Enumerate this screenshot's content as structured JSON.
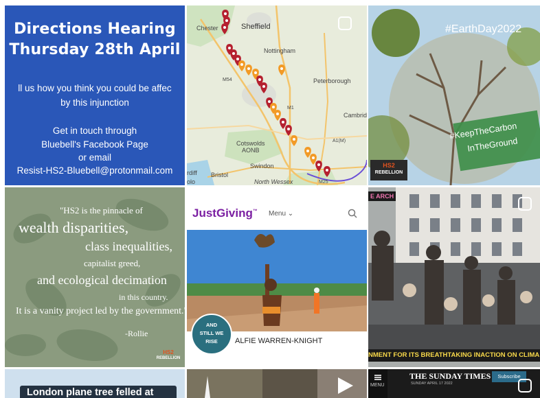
{
  "tiles": {
    "directions": {
      "title_line1": "Directions Hearing",
      "title_line2": "Thursday 28th April",
      "body_line1": "ll us how you think you could be affec",
      "body_line2": "by this injunction",
      "body_line3": "Get in touch through",
      "body_line4": "Bluebell's Facebook Page",
      "body_line5": "or email",
      "body_line6": "Resist-HS2-Bluebell@protonmail.com"
    },
    "map": {
      "labels": {
        "chester": "Chester",
        "sheffield": "Sheffield",
        "nottingham": "Nottingham",
        "peterborough": "Peterborough",
        "cambrid": "Cambrid",
        "cotswolds": "Cotswolds",
        "aonb": "AONB",
        "swindon": "Swindon",
        "bristol": "Bristol",
        "rdiff": "rdiff",
        "north_wessex": "North Wessex",
        "olo": "olo",
        "m54": "M54",
        "m1": "M1",
        "a1m": "A1(M)",
        "m25": "M25"
      }
    },
    "earthday": {
      "hashtag_top": "#EarthDay2022",
      "hashtag_line1": "#KeepTheCarbon",
      "hashtag_line2": "InTheGround",
      "badge_line1": "HS2",
      "badge_line2": "REBELLION"
    },
    "quote": {
      "line1": "\"HS2 is the pinnacle of",
      "line2": "wealth disparities,",
      "line3": "class inequalities,",
      "line4": "capitalist greed,",
      "line5": "and ecological decimation",
      "line6": "in this country.",
      "line7": "It is a vanity project led by the government.\"",
      "author": "-Rollie",
      "badge_line1": "HS2",
      "badge_line2": "REBELLION"
    },
    "justgiving": {
      "logo": "JustGiving",
      "logo_tm": "™",
      "menu": "Menu",
      "avatar_text_line1": "AND",
      "avatar_text_line2": "STILL WE",
      "avatar_text_line3": "RISE",
      "fundraiser_name": "ALFIE WARREN-KNIGHT"
    },
    "protest": {
      "corner_text": "E ARCH",
      "banner": "NMENT FOR ITS BREATHTAKING INACTION ON CLIMA"
    },
    "plane_tree": {
      "text": "London plane tree felled at"
    },
    "sunday_times": {
      "masthead": "THE SUNDAY TIMES",
      "date": "SUNDAY APRIL 17 2022",
      "subscribe": "Subscribe",
      "menu": "MENU"
    }
  },
  "colors": {
    "directions_bg": "#2a57b8",
    "earthday_green": "#3f8f4a",
    "justgiving_purple": "#7b1fa2",
    "banner_yellow": "#f8d94a"
  },
  "icons": [
    "multi-post-icon",
    "search-icon",
    "chevron-down-icon",
    "play-icon",
    "menu-icon"
  ]
}
